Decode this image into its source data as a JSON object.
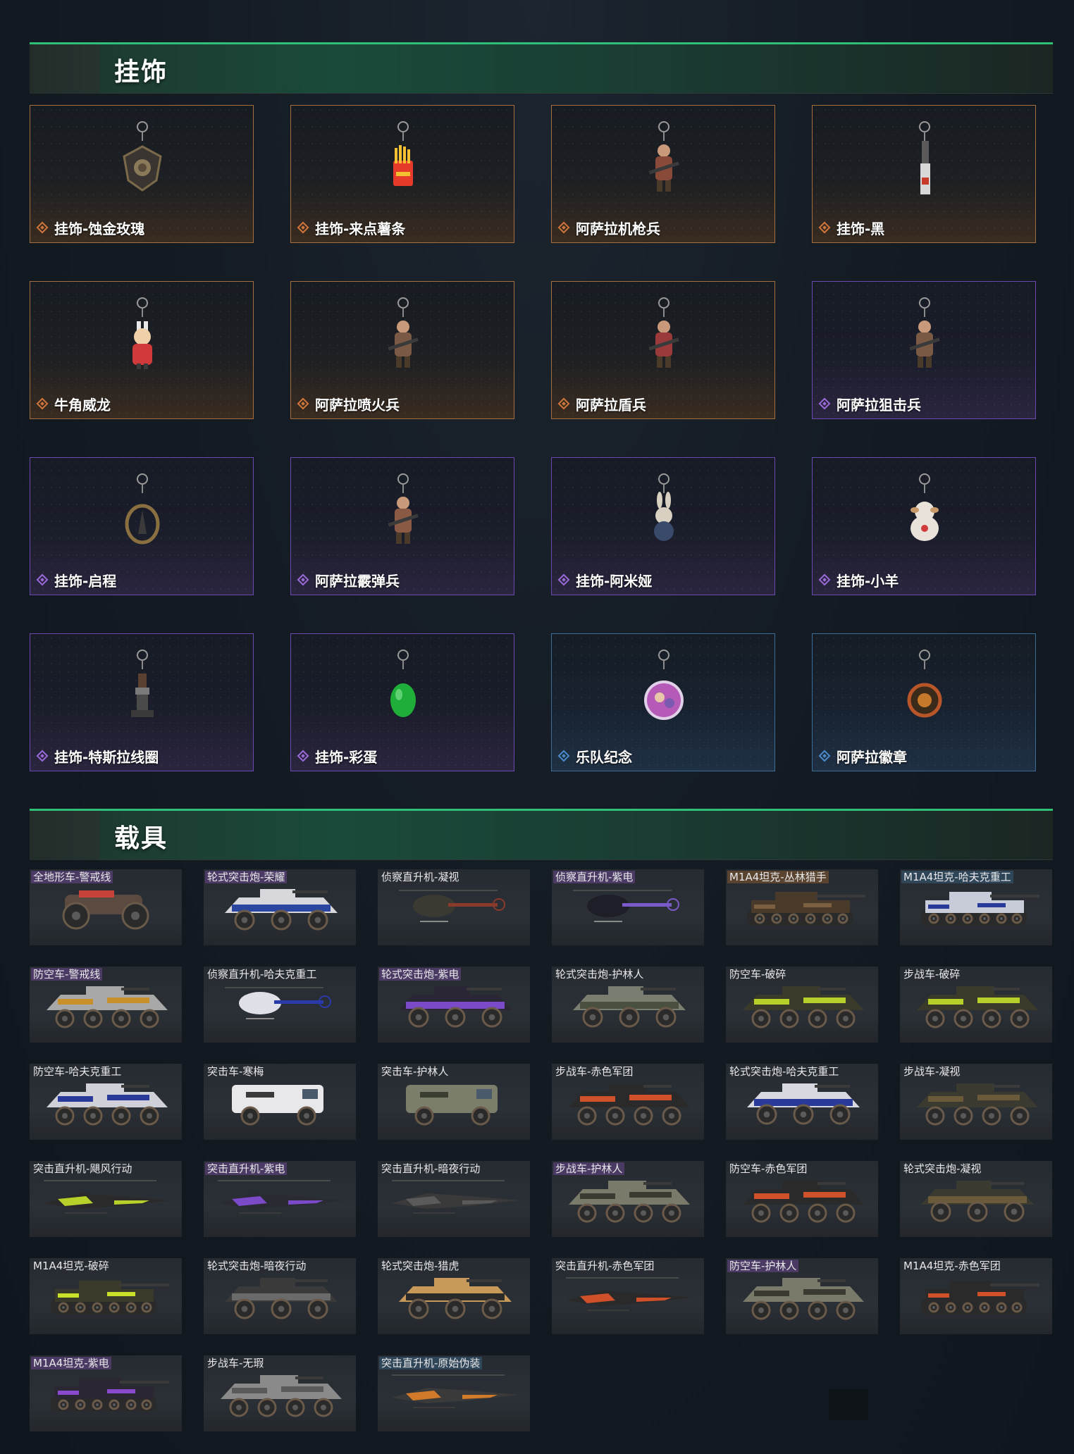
{
  "charms_section": {
    "title": "挂饰"
  },
  "vehicles_section": {
    "title": "载具"
  },
  "charms": [
    {
      "name": "挂饰-蚀金玫瑰",
      "rarity": "gold",
      "icon": "charm-rose-medallion-icon",
      "color": "#7a6a4a"
    },
    {
      "name": "挂饰-来点薯条",
      "rarity": "gold",
      "icon": "charm-fries-icon",
      "color": "#e63b2a"
    },
    {
      "name": "阿萨拉机枪兵",
      "rarity": "gold",
      "icon": "charm-machine-gunner-icon",
      "color": "#8a4a3a"
    },
    {
      "name": "挂饰-黑",
      "rarity": "gold",
      "icon": "charm-knife-icon",
      "color": "#c9c9c9"
    },
    {
      "name": "牛角威龙",
      "rarity": "gold",
      "icon": "charm-horned-dragon-icon",
      "color": "#d13a3a"
    },
    {
      "name": "阿萨拉喷火兵",
      "rarity": "gold",
      "icon": "charm-flamethrower-icon",
      "color": "#7a5a45"
    },
    {
      "name": "阿萨拉盾兵",
      "rarity": "gold",
      "icon": "charm-shield-soldier-icon",
      "color": "#9a3a3a"
    },
    {
      "name": "阿萨拉狙击兵",
      "rarity": "purple",
      "icon": "charm-sniper-icon",
      "color": "#7a5a45"
    },
    {
      "name": "挂饰-启程",
      "rarity": "purple",
      "icon": "charm-compass-icon",
      "color": "#8a7040"
    },
    {
      "name": "阿萨拉霰弹兵",
      "rarity": "purple",
      "icon": "charm-shotgunner-icon",
      "color": "#8a5a45"
    },
    {
      "name": "挂饰-阿米娅",
      "rarity": "purple",
      "icon": "charm-bunny-icon",
      "color": "#d8d0c0"
    },
    {
      "name": "挂饰-小羊",
      "rarity": "purple",
      "icon": "charm-lamb-icon",
      "color": "#e8e2da"
    },
    {
      "name": "挂饰-特斯拉线圈",
      "rarity": "purple",
      "icon": "charm-tesla-coil-icon",
      "color": "#6a6a6a"
    },
    {
      "name": "挂饰-彩蛋",
      "rarity": "purple",
      "icon": "charm-egg-icon",
      "color": "#1fae3a"
    },
    {
      "name": "乐队纪念",
      "rarity": "blue",
      "icon": "charm-band-badge-icon",
      "color": "#b65ab8"
    },
    {
      "name": "阿萨拉徽章",
      "rarity": "blue",
      "icon": "charm-emblem-icon",
      "color": "#b8562a"
    }
  ],
  "vehicles": [
    {
      "label": "全地形车-警戒线",
      "hl": "purple",
      "type": "atv",
      "body": "#5a4a40",
      "accent": "#c8423a"
    },
    {
      "label": "轮式突击炮-荣耀",
      "hl": "purple",
      "type": "wheeled",
      "body": "#d8d8dc",
      "accent": "#2a46a0"
    },
    {
      "label": "侦察直升机-凝视",
      "hl": "none",
      "type": "heli-small",
      "body": "#3a3a32",
      "accent": "#8a3a2a"
    },
    {
      "label": "侦察直升机-紫电",
      "hl": "purple",
      "type": "heli-small",
      "body": "#1e1e28",
      "accent": "#7a5ac8"
    },
    {
      "label": "M1A4坦克-丛林猎手",
      "hl": "gold",
      "type": "tank",
      "body": "#4a3a2a",
      "accent": "#7a6040"
    },
    {
      "label": "M1A4坦克-哈夫克重工",
      "hl": "blue",
      "type": "tank",
      "body": "#c8ccd8",
      "accent": "#2a3a9a"
    },
    {
      "label": "防空车-警戒线",
      "hl": "purple",
      "type": "apc8",
      "body": "#a8a8a8",
      "accent": "#c8902a"
    },
    {
      "label": "侦察直升机-哈夫克重工",
      "hl": "none",
      "type": "heli-small",
      "body": "#e0e0e8",
      "accent": "#2a3aa8"
    },
    {
      "label": "轮式突击炮-紫电",
      "hl": "purple",
      "type": "wheeled",
      "body": "#2a2636",
      "accent": "#7a4ac8"
    },
    {
      "label": "轮式突击炮-护林人",
      "hl": "none",
      "type": "wheeled",
      "body": "#7a7e70",
      "accent": "#4a5040"
    },
    {
      "label": "防空车-破碎",
      "hl": "none",
      "type": "apc8",
      "body": "#3a3a2a",
      "accent": "#b8d02a"
    },
    {
      "label": "步战车-破碎",
      "hl": "none",
      "type": "apc8",
      "body": "#3a3a2a",
      "accent": "#b8d02a"
    },
    {
      "label": "防空车-哈夫克重工",
      "hl": "none",
      "type": "apc8",
      "body": "#d0d0d8",
      "accent": "#2a3a9a"
    },
    {
      "label": "突击车-寒梅",
      "hl": "none",
      "type": "truck",
      "body": "#e8e8ea",
      "accent": "#3a3a3a"
    },
    {
      "label": "突击车-护林人",
      "hl": "none",
      "type": "truck",
      "body": "#7a7e6a",
      "accent": "#3a3e30"
    },
    {
      "label": "步战车-赤色军团",
      "hl": "none",
      "type": "apc8",
      "body": "#2a2a2a",
      "accent": "#d0502a"
    },
    {
      "label": "轮式突击炮-哈夫克重工",
      "hl": "none",
      "type": "wheeled",
      "body": "#d8d8e0",
      "accent": "#2a3a9a"
    },
    {
      "label": "步战车-凝视",
      "hl": "none",
      "type": "apc8",
      "body": "#3a3a30",
      "accent": "#6a5a3a"
    },
    {
      "label": "突击直升机-飓风行动",
      "hl": "none",
      "type": "heli-attack",
      "body": "#2a2a2a",
      "accent": "#b8d02a"
    },
    {
      "label": "突击直升机-紫电",
      "hl": "purple",
      "type": "heli-attack",
      "body": "#2a2a32",
      "accent": "#7a4ac8"
    },
    {
      "label": "突击直升机-暗夜行动",
      "hl": "none",
      "type": "heli-attack",
      "body": "#3a3a3a",
      "accent": "#5a5a5a"
    },
    {
      "label": "步战车-护林人",
      "hl": "purple",
      "type": "apc8",
      "body": "#7a7a6a",
      "accent": "#3a3a30"
    },
    {
      "label": "防空车-赤色军团",
      "hl": "none",
      "type": "apc8",
      "body": "#2a2a2a",
      "accent": "#d0502a"
    },
    {
      "label": "轮式突击炮-凝视",
      "hl": "none",
      "type": "wheeled",
      "body": "#3a3a30",
      "accent": "#6a5a3a"
    },
    {
      "label": "M1A4坦克-破碎",
      "hl": "none",
      "type": "tank",
      "body": "#3a3a2a",
      "accent": "#c8e02a"
    },
    {
      "label": "轮式突击炮-暗夜行动",
      "hl": "none",
      "type": "wheeled",
      "body": "#3a3a3a",
      "accent": "#6a6a6a"
    },
    {
      "label": "轮式突击炮-猎虎",
      "hl": "none",
      "type": "wheeled",
      "body": "#c89a5a",
      "accent": "#2a2a2a"
    },
    {
      "label": "突击直升机-赤色军团",
      "hl": "none",
      "type": "heli-attack",
      "body": "#2a2a2a",
      "accent": "#d0502a"
    },
    {
      "label": "防空车-护林人",
      "hl": "purple",
      "type": "apc8",
      "body": "#7a7a6a",
      "accent": "#3a3a30"
    },
    {
      "label": "M1A4坦克-赤色军团",
      "hl": "none",
      "type": "tank",
      "body": "#2a2a2a",
      "accent": "#d0502a"
    },
    {
      "label": "M1A4坦克-紫电",
      "hl": "purple",
      "type": "tank",
      "body": "#2a2632",
      "accent": "#8a4ad0"
    },
    {
      "label": "步战车-无瑕",
      "hl": "none",
      "type": "apc8",
      "body": "#8a8a8a",
      "accent": "#5a5a5a"
    },
    {
      "label": "突击直升机-原始伪装",
      "hl": "blue",
      "type": "heli-attack",
      "body": "#3a3a3a",
      "accent": "#d07a2a"
    }
  ],
  "colors": {
    "gold_border": "#a56e3e",
    "purple_border": "#6a4ab0",
    "blue_border": "#3b6d96",
    "header_green": "#2fbf78"
  }
}
